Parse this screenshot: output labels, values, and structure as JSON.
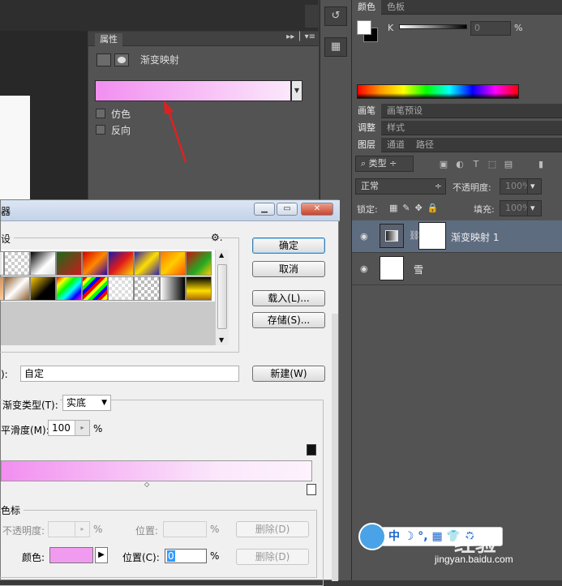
{
  "properties_panel": {
    "tab_title": "属性",
    "layer_label": "渐变映射",
    "dither_label": "仿色",
    "reverse_label": "反向",
    "gradient_start_color": "#f28ef0",
    "gradient_end_color": "#fbe8fb"
  },
  "color_panel": {
    "tabs": [
      "颜色",
      "色板"
    ],
    "channel_label": "K",
    "channel_value": "0",
    "unit": "%"
  },
  "brush_tabs": [
    "画笔",
    "画笔预设"
  ],
  "adjust_tabs": [
    "调整",
    "样式"
  ],
  "layers_panel": {
    "tabs": [
      "图层",
      "通道",
      "路径"
    ],
    "filter_label": "类型",
    "blend_mode": "正常",
    "opacity_label": "不透明度:",
    "opacity_value": "100%",
    "lock_label": "锁定:",
    "fill_label": "填充:",
    "fill_value": "100%",
    "layers": [
      {
        "name": "渐变映射 1",
        "selected": true
      },
      {
        "name": "雪",
        "selected": false
      }
    ]
  },
  "dialog": {
    "title_fragment": "器",
    "presets_label": "设",
    "buttons": {
      "ok": "确定",
      "cancel": "取消",
      "load": "载入(L)...",
      "save": "存储(S)...",
      "new": "新建(W)"
    },
    "name_label_fragment": "):",
    "name_value": "自定",
    "gradient_type_label": "渐变类型(T):",
    "gradient_type_value": "实底",
    "smoothness_label": "平滑度(M):",
    "smoothness_value": "100",
    "smoothness_unit": "%",
    "stops_group_label": "色标",
    "opacity_label": "不透明度:",
    "opacity_unit": "%",
    "location_label": "位置:",
    "location_unit": "%",
    "delete_label": "删除(D)",
    "color_label": "颜色:",
    "color_location_label": "位置(C):",
    "color_location_value": "0",
    "color_location_unit": "%",
    "stop_color": "#f19bf0"
  },
  "watermark": {
    "bar_text": "中 ☽ °, ▦ 👕 ⚙",
    "brand": "经验",
    "url": "jingyan.baidu.com"
  }
}
